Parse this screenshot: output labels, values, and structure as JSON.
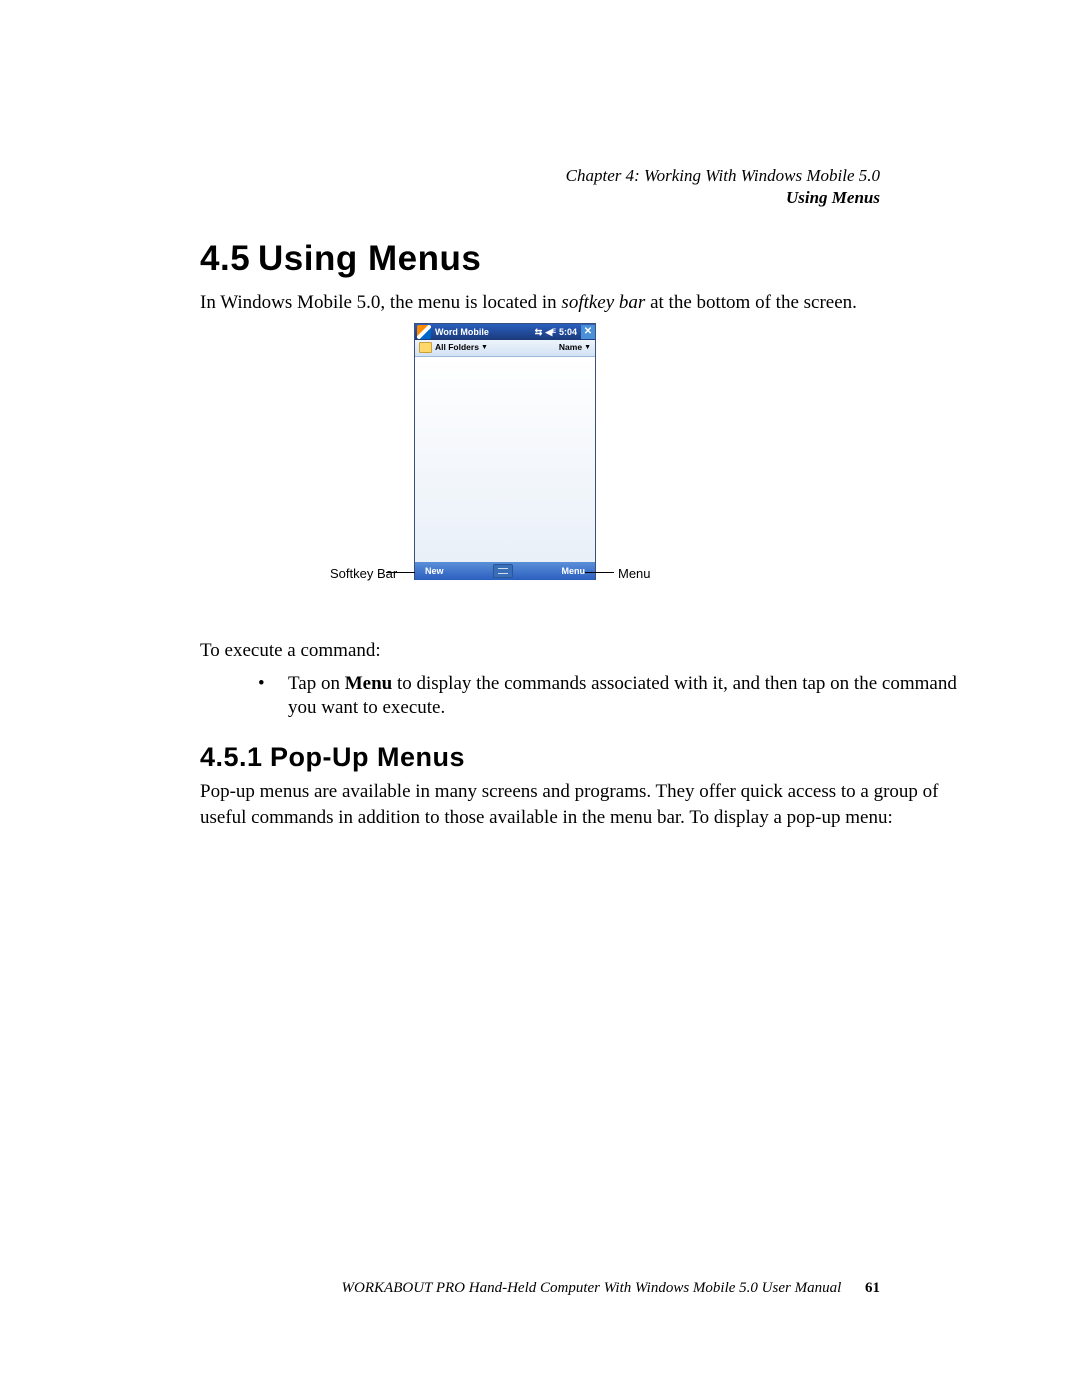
{
  "header": {
    "chapter_line": "Chapter  4:  Working With Windows Mobile 5.0",
    "section_line": "Using Menus"
  },
  "section45": {
    "number": "4.5",
    "title": "Using Menus",
    "intro_pre": "In Windows Mobile 5.0, the menu is located in ",
    "intro_em": "softkey bar",
    "intro_post": " at the bottom of the screen."
  },
  "figure": {
    "titlebar": {
      "app": "Word Mobile",
      "time": "5:04"
    },
    "toolbar": {
      "left": "All Folders",
      "right": "Name"
    },
    "softkey": {
      "left": "New",
      "right": "Menu"
    },
    "callouts": {
      "left_label": "Softkey Bar",
      "right_label": "Menu"
    }
  },
  "execute_intro": "To execute a command:",
  "bullet1": {
    "pre": "Tap on ",
    "bold": "Menu",
    "post": " to display the commands associated with it, and then tap on the command you want to execute."
  },
  "section451": {
    "number": "4.5.1",
    "title": "Pop-Up Menus",
    "para": "Pop-up menus are available in many screens and programs. They offer quick access to a group of useful commands in addition to those available in the menu bar. To display a pop-up menu:"
  },
  "footer": {
    "text": "WORKABOUT PRO Hand-Held Computer With Windows Mobile 5.0 User Manual",
    "page": "61"
  }
}
